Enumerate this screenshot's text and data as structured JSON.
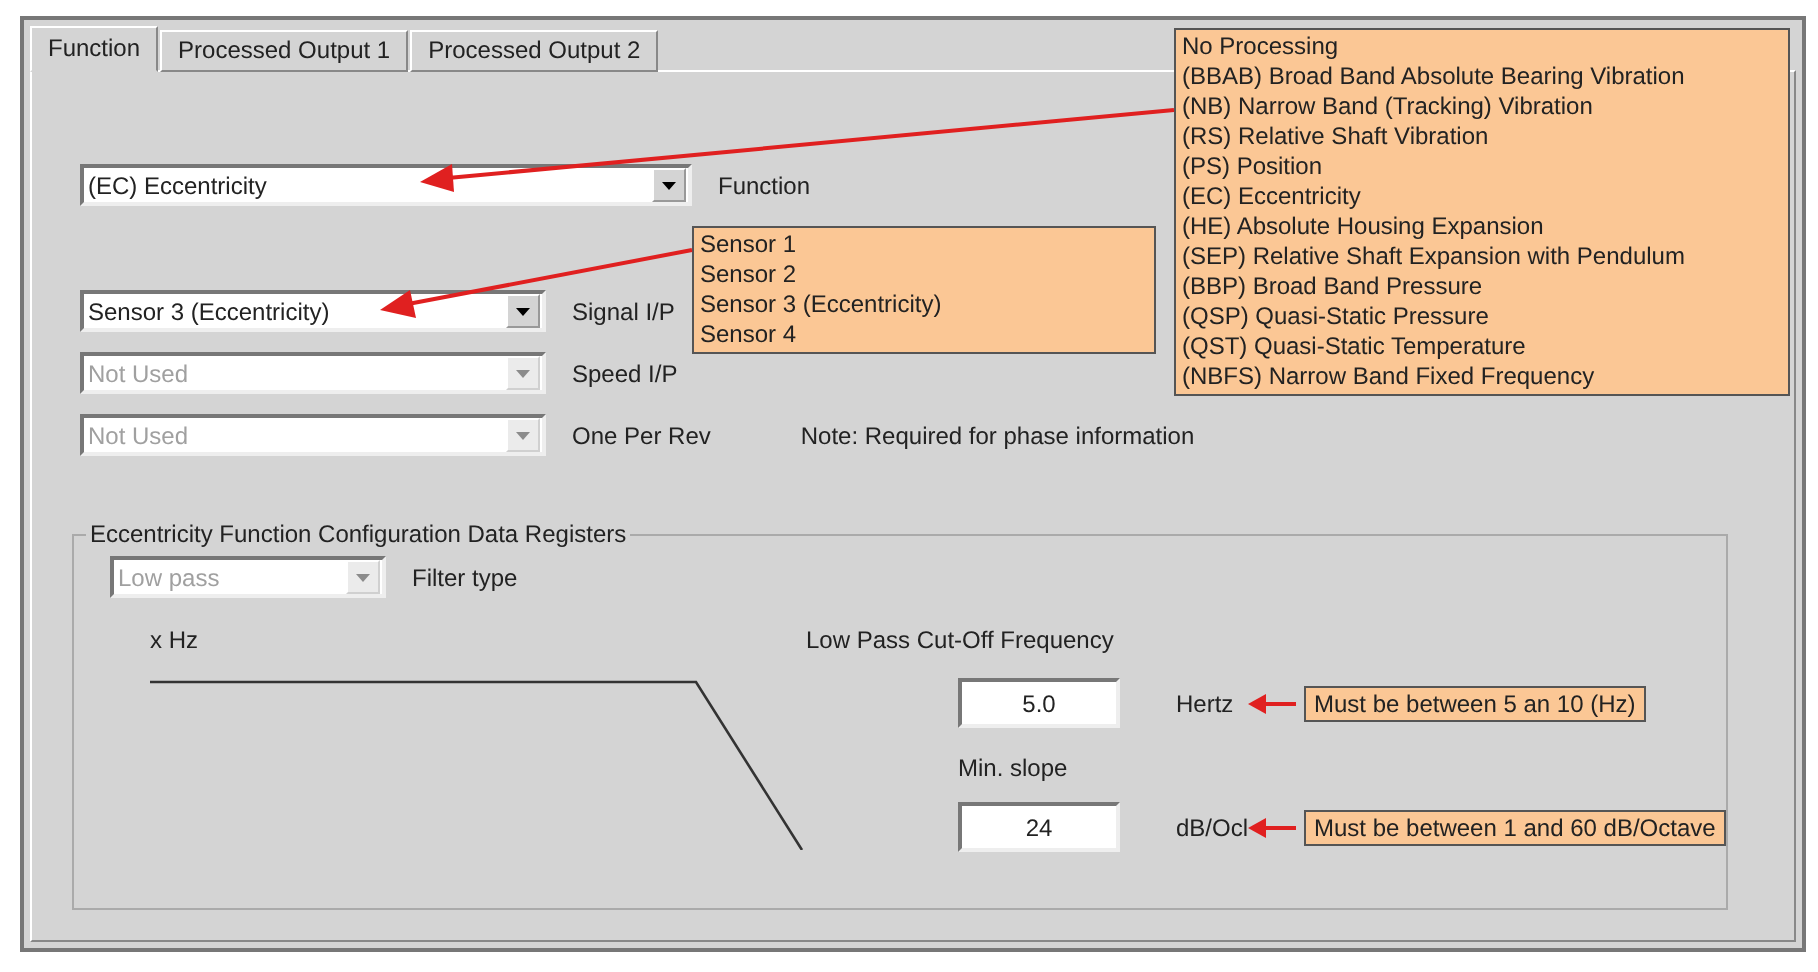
{
  "tabs": [
    {
      "label": "Function",
      "selected": true
    },
    {
      "label": "Processed Output 1",
      "selected": false
    },
    {
      "label": "Processed Output 2",
      "selected": false
    }
  ],
  "function_select": {
    "value": "(EC)  Eccentricity",
    "label": "Function",
    "disabled": false
  },
  "inputs": [
    {
      "value": "Sensor 3 (Eccentricity)",
      "label": "Signal I/P",
      "disabled": false
    },
    {
      "value": "Not Used",
      "label": "Speed I/P",
      "disabled": true
    },
    {
      "value": "Not Used",
      "label": "One Per Rev",
      "disabled": true
    }
  ],
  "note": "Note: Required for phase information",
  "group": {
    "title": "Eccentricity Function Configuration Data Registers",
    "filter": {
      "value": "Low pass",
      "label": "Filter type",
      "disabled": true
    },
    "x_label": "x Hz",
    "cutoff_label": "Low Pass Cut-Off Frequency",
    "fields": [
      {
        "value": "5.0",
        "unit": "Hertz",
        "callout": "Must be between 5 an 10 (Hz)"
      },
      {
        "caption": "Min. slope",
        "value": "24",
        "unit": "dB/Ocl",
        "callout": "Must be between 1 and 60 dB/Octave"
      }
    ]
  },
  "function_options": [
    "No Processing",
    "(BBAB) Broad Band Absolute Bearing Vibration",
    "(NB)  Narrow Band (Tracking) Vibration",
    "(RS)  Relative Shaft Vibration",
    "(PS)  Position",
    "(EC)  Eccentricity",
    "(HE)  Absolute Housing Expansion",
    "(SEP) Relative Shaft Expansion with Pendulum",
    "(BBP) Broad Band Pressure",
    "(QSP) Quasi-Static Pressure",
    "(QST) Quasi-Static Temperature",
    "(NBFS)  Narrow Band Fixed Frequency"
  ],
  "signal_options": [
    "Sensor 1",
    "Sensor 2",
    "Sensor 3 (Eccentricity)",
    "Sensor 4"
  ]
}
